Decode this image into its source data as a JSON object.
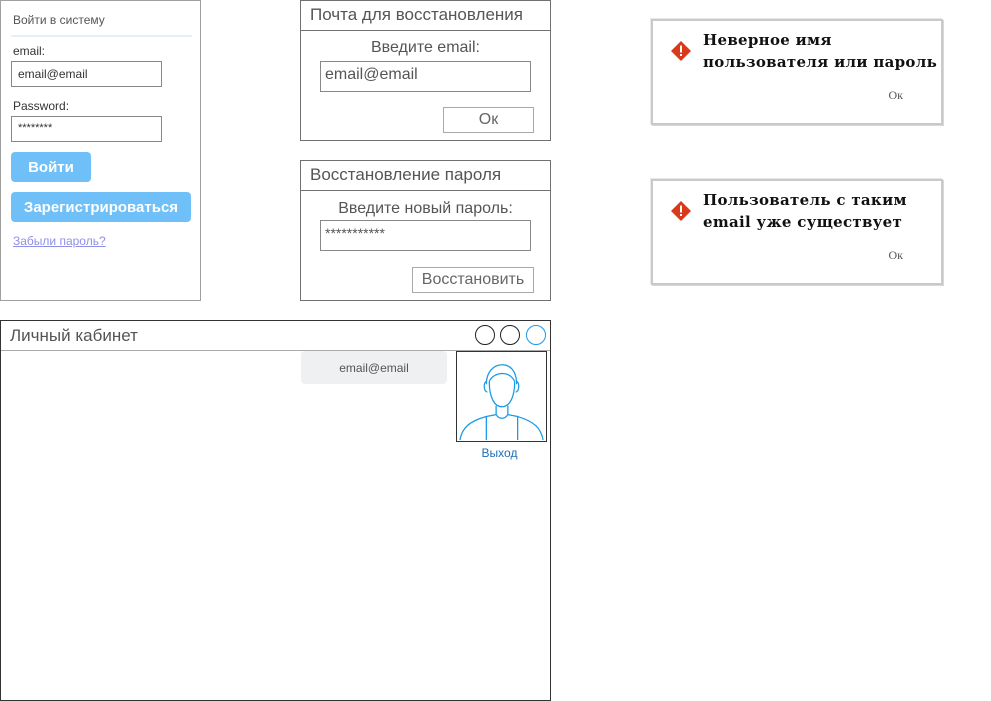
{
  "login": {
    "title": "Войти в систему",
    "email_label": "email:",
    "email_value": "email@email",
    "password_label": "Password:",
    "password_value": "********",
    "login_button": "Войти",
    "register_button": "Зарегистрироваться",
    "forgot_link": "Забыли пароль?"
  },
  "recovery_email": {
    "title": "Почта для восстановления",
    "caption": "Введите email:",
    "email_value": "email@email",
    "ok_button": "Ок"
  },
  "password_reset": {
    "title": "Восстановление пароля",
    "caption": "Введите новый пароль:",
    "password_value": "***********",
    "restore_button": "Восстановить"
  },
  "alerts": [
    {
      "icon": "warning-icon",
      "message": "Неверное имя пользователя или пароль",
      "ok": "Ок"
    },
    {
      "icon": "warning-icon",
      "message": "Пользователь с таким email уже существует",
      "ok": "Ок"
    }
  ],
  "cabinet": {
    "title": "Личный кабинет",
    "email": "email@email",
    "logout": "Выход",
    "avatar_icon": "user-avatar-icon"
  },
  "colors": {
    "primary_button": "#6fbff8",
    "link": "#8f8fe8",
    "logout_link": "#1f6db5",
    "warning": "#d93a1c",
    "avatar_stroke": "#1a9ae6"
  }
}
